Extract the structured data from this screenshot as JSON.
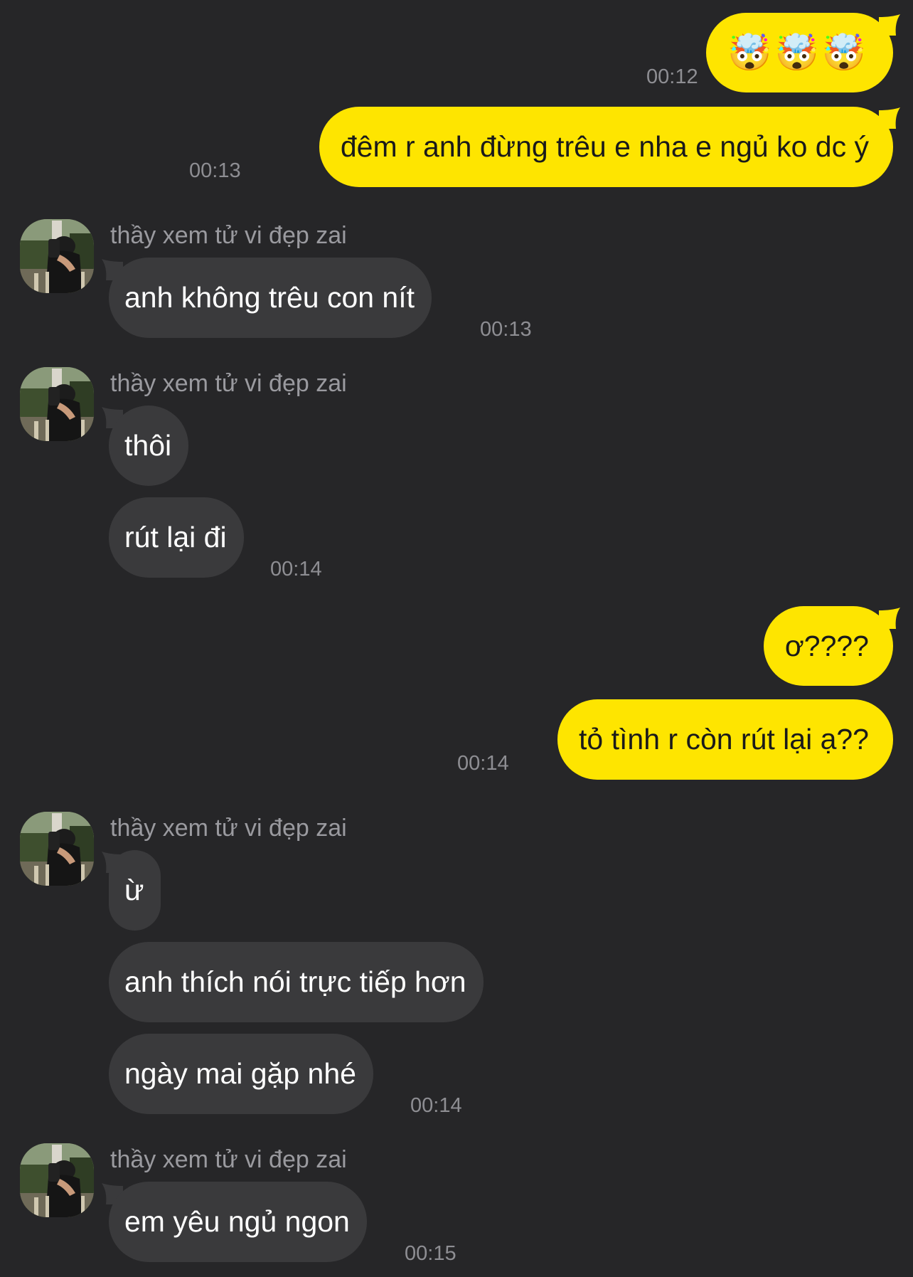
{
  "colors": {
    "background": "#262628",
    "outgoing_bubble": "#fee500",
    "incoming_bubble": "#3a3a3c",
    "timestamp": "#8e8e93"
  },
  "contact": {
    "name": "thầy xem tử vi đẹp zai",
    "avatar_icon": "profile-photo"
  },
  "messages": [
    {
      "direction": "out",
      "text": "🤯🤯🤯",
      "time": "00:12"
    },
    {
      "direction": "out",
      "text": "đêm r anh đừng trêu e nha e ngủ ko dc ý",
      "time": "00:13"
    },
    {
      "direction": "in",
      "sender": "thầy xem tử vi đẹp zai",
      "text": "anh không trêu con nít",
      "time": "00:13"
    },
    {
      "direction": "in",
      "sender": "thầy xem tử vi đẹp zai",
      "text": "thôi"
    },
    {
      "direction": "in",
      "text": "rút lại đi",
      "time": "00:14"
    },
    {
      "direction": "out",
      "text": "ơ????"
    },
    {
      "direction": "out",
      "text": "tỏ tình r còn rút lại ạ??",
      "time": "00:14"
    },
    {
      "direction": "in",
      "sender": "thầy xem tử vi đẹp zai",
      "text": "ừ"
    },
    {
      "direction": "in",
      "text": "anh thích nói trực tiếp hơn"
    },
    {
      "direction": "in",
      "text": "ngày mai gặp nhé",
      "time": "00:14"
    },
    {
      "direction": "in",
      "sender": "thầy xem tử vi đẹp zai",
      "text": "em yêu ngủ ngon",
      "time": "00:15"
    }
  ]
}
